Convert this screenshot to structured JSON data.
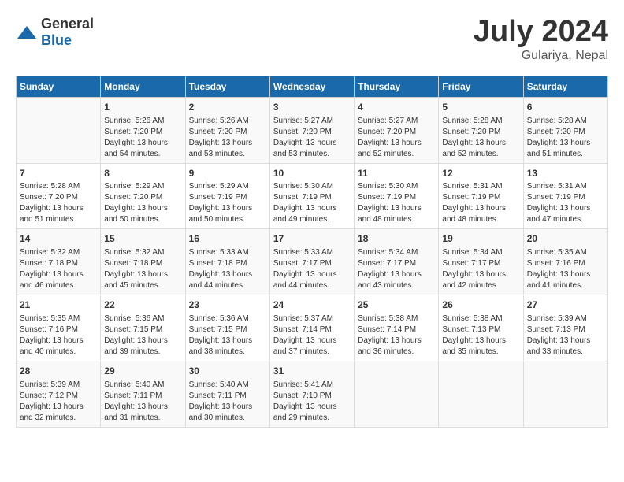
{
  "header": {
    "logo": {
      "general": "General",
      "blue": "Blue"
    },
    "title": "July 2024",
    "location": "Gulariya, Nepal"
  },
  "calendar": {
    "weekdays": [
      "Sunday",
      "Monday",
      "Tuesday",
      "Wednesday",
      "Thursday",
      "Friday",
      "Saturday"
    ],
    "weeks": [
      [
        {
          "day": "",
          "info": ""
        },
        {
          "day": "1",
          "info": "Sunrise: 5:26 AM\nSunset: 7:20 PM\nDaylight: 13 hours\nand 54 minutes."
        },
        {
          "day": "2",
          "info": "Sunrise: 5:26 AM\nSunset: 7:20 PM\nDaylight: 13 hours\nand 53 minutes."
        },
        {
          "day": "3",
          "info": "Sunrise: 5:27 AM\nSunset: 7:20 PM\nDaylight: 13 hours\nand 53 minutes."
        },
        {
          "day": "4",
          "info": "Sunrise: 5:27 AM\nSunset: 7:20 PM\nDaylight: 13 hours\nand 52 minutes."
        },
        {
          "day": "5",
          "info": "Sunrise: 5:28 AM\nSunset: 7:20 PM\nDaylight: 13 hours\nand 52 minutes."
        },
        {
          "day": "6",
          "info": "Sunrise: 5:28 AM\nSunset: 7:20 PM\nDaylight: 13 hours\nand 51 minutes."
        }
      ],
      [
        {
          "day": "7",
          "info": "Sunrise: 5:28 AM\nSunset: 7:20 PM\nDaylight: 13 hours\nand 51 minutes."
        },
        {
          "day": "8",
          "info": "Sunrise: 5:29 AM\nSunset: 7:20 PM\nDaylight: 13 hours\nand 50 minutes."
        },
        {
          "day": "9",
          "info": "Sunrise: 5:29 AM\nSunset: 7:19 PM\nDaylight: 13 hours\nand 50 minutes."
        },
        {
          "day": "10",
          "info": "Sunrise: 5:30 AM\nSunset: 7:19 PM\nDaylight: 13 hours\nand 49 minutes."
        },
        {
          "day": "11",
          "info": "Sunrise: 5:30 AM\nSunset: 7:19 PM\nDaylight: 13 hours\nand 48 minutes."
        },
        {
          "day": "12",
          "info": "Sunrise: 5:31 AM\nSunset: 7:19 PM\nDaylight: 13 hours\nand 48 minutes."
        },
        {
          "day": "13",
          "info": "Sunrise: 5:31 AM\nSunset: 7:19 PM\nDaylight: 13 hours\nand 47 minutes."
        }
      ],
      [
        {
          "day": "14",
          "info": "Sunrise: 5:32 AM\nSunset: 7:18 PM\nDaylight: 13 hours\nand 46 minutes."
        },
        {
          "day": "15",
          "info": "Sunrise: 5:32 AM\nSunset: 7:18 PM\nDaylight: 13 hours\nand 45 minutes."
        },
        {
          "day": "16",
          "info": "Sunrise: 5:33 AM\nSunset: 7:18 PM\nDaylight: 13 hours\nand 44 minutes."
        },
        {
          "day": "17",
          "info": "Sunrise: 5:33 AM\nSunset: 7:17 PM\nDaylight: 13 hours\nand 44 minutes."
        },
        {
          "day": "18",
          "info": "Sunrise: 5:34 AM\nSunset: 7:17 PM\nDaylight: 13 hours\nand 43 minutes."
        },
        {
          "day": "19",
          "info": "Sunrise: 5:34 AM\nSunset: 7:17 PM\nDaylight: 13 hours\nand 42 minutes."
        },
        {
          "day": "20",
          "info": "Sunrise: 5:35 AM\nSunset: 7:16 PM\nDaylight: 13 hours\nand 41 minutes."
        }
      ],
      [
        {
          "day": "21",
          "info": "Sunrise: 5:35 AM\nSunset: 7:16 PM\nDaylight: 13 hours\nand 40 minutes."
        },
        {
          "day": "22",
          "info": "Sunrise: 5:36 AM\nSunset: 7:15 PM\nDaylight: 13 hours\nand 39 minutes."
        },
        {
          "day": "23",
          "info": "Sunrise: 5:36 AM\nSunset: 7:15 PM\nDaylight: 13 hours\nand 38 minutes."
        },
        {
          "day": "24",
          "info": "Sunrise: 5:37 AM\nSunset: 7:14 PM\nDaylight: 13 hours\nand 37 minutes."
        },
        {
          "day": "25",
          "info": "Sunrise: 5:38 AM\nSunset: 7:14 PM\nDaylight: 13 hours\nand 36 minutes."
        },
        {
          "day": "26",
          "info": "Sunrise: 5:38 AM\nSunset: 7:13 PM\nDaylight: 13 hours\nand 35 minutes."
        },
        {
          "day": "27",
          "info": "Sunrise: 5:39 AM\nSunset: 7:13 PM\nDaylight: 13 hours\nand 33 minutes."
        }
      ],
      [
        {
          "day": "28",
          "info": "Sunrise: 5:39 AM\nSunset: 7:12 PM\nDaylight: 13 hours\nand 32 minutes."
        },
        {
          "day": "29",
          "info": "Sunrise: 5:40 AM\nSunset: 7:11 PM\nDaylight: 13 hours\nand 31 minutes."
        },
        {
          "day": "30",
          "info": "Sunrise: 5:40 AM\nSunset: 7:11 PM\nDaylight: 13 hours\nand 30 minutes."
        },
        {
          "day": "31",
          "info": "Sunrise: 5:41 AM\nSunset: 7:10 PM\nDaylight: 13 hours\nand 29 minutes."
        },
        {
          "day": "",
          "info": ""
        },
        {
          "day": "",
          "info": ""
        },
        {
          "day": "",
          "info": ""
        }
      ]
    ]
  }
}
